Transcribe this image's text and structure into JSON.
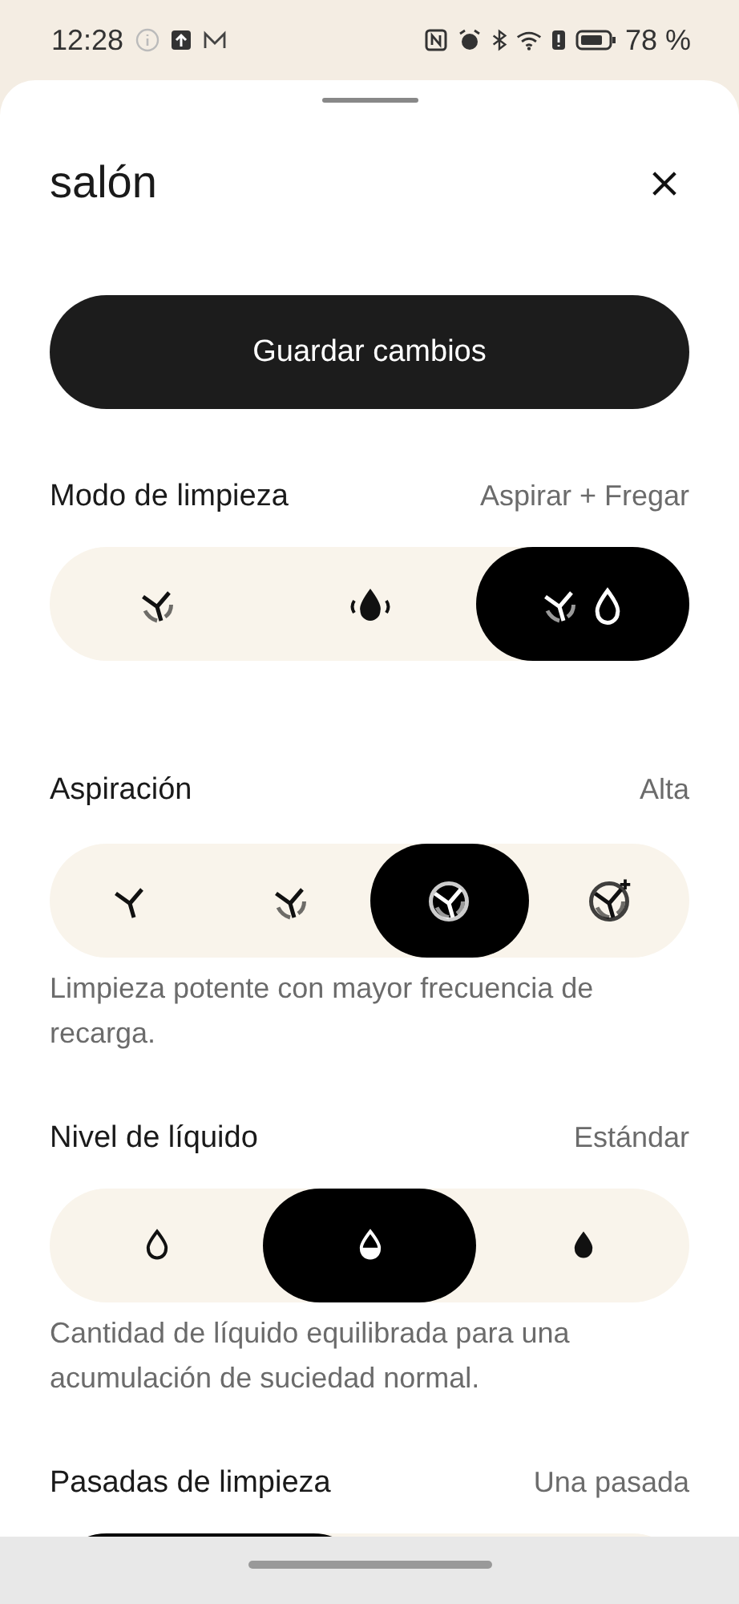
{
  "status_bar": {
    "time": "12:28",
    "battery": "78 %"
  },
  "sheet": {
    "title": "salón",
    "save_button": "Guardar cambios"
  },
  "sections": [
    {
      "kind": "mode",
      "title": "Modo de limpieza",
      "value": "Aspirar + Fregar",
      "options": [
        {
          "selected": false
        },
        {
          "selected": false
        },
        {
          "selected": true
        }
      ]
    },
    {
      "kind": "suction",
      "title": "Aspiración",
      "value": "Alta",
      "description": "Limpieza potente con mayor frecuencia de recarga.",
      "options": [
        {
          "selected": false
        },
        {
          "selected": false
        },
        {
          "selected": true
        },
        {
          "selected": false
        }
      ]
    },
    {
      "kind": "liquid",
      "title": "Nivel de líquido",
      "value": "Estándar",
      "description": "Cantidad de líquido equilibrada para una acumulación de suciedad normal.",
      "options": [
        {
          "selected": false
        },
        {
          "selected": true
        },
        {
          "selected": false
        }
      ]
    },
    {
      "kind": "passes",
      "title": "Pasadas de limpieza",
      "value": "Una pasada",
      "options": [
        {
          "selected": true
        },
        {
          "selected": false
        }
      ]
    }
  ]
}
